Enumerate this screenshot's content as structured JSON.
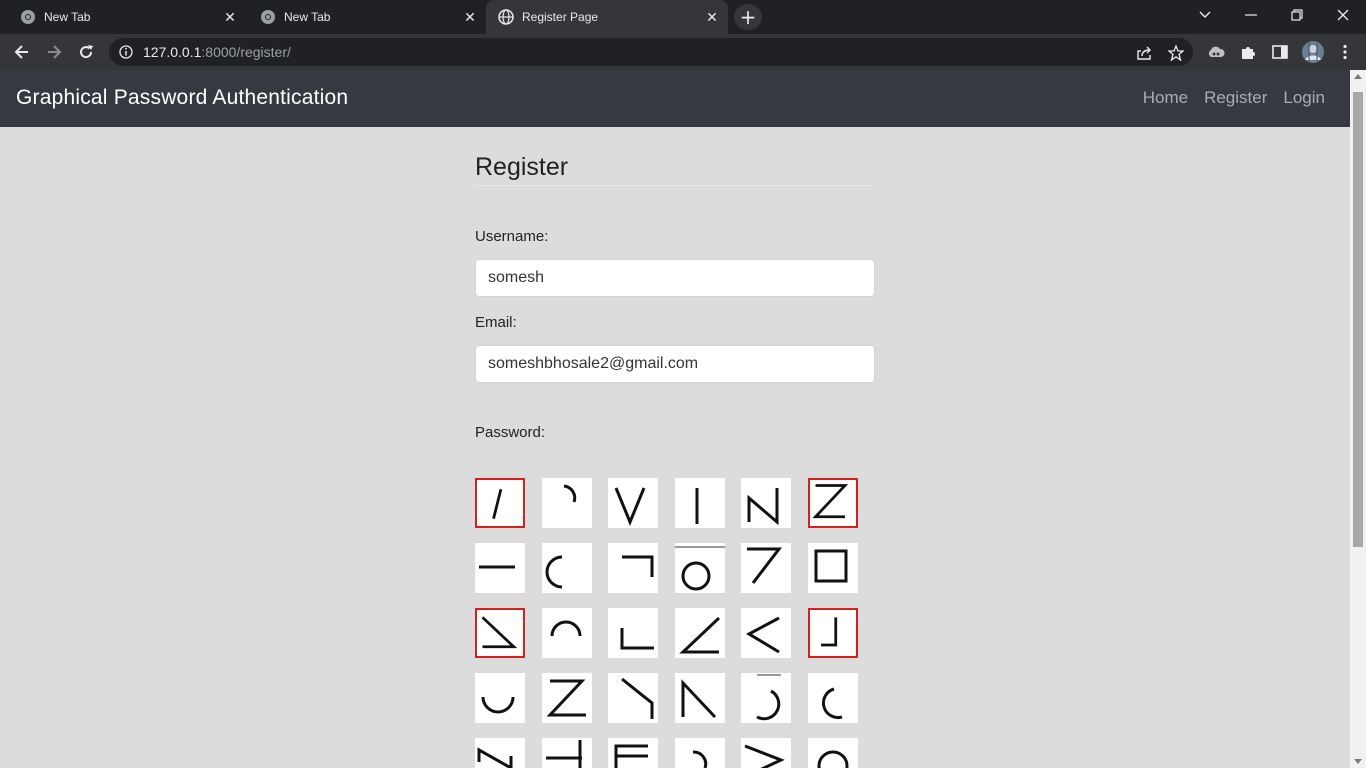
{
  "browser": {
    "tabs": [
      {
        "title": "New Tab",
        "active": false
      },
      {
        "title": "New Tab",
        "active": false
      },
      {
        "title": "Register Page",
        "active": true
      }
    ],
    "url_host": "127.0.0.1",
    "url_rest": ":8000/register/",
    "window_controls": [
      "chevron-down-icon",
      "minimize-icon",
      "restore-icon",
      "close-icon"
    ],
    "toolbar_icons": [
      "back-icon",
      "forward-icon",
      "reload-icon",
      "info-icon",
      "share-icon",
      "star-icon",
      "extension-cloud-icon",
      "puzzle-icon",
      "sidepanel-icon",
      "profile-avatar",
      "kebab-menu-icon"
    ]
  },
  "navbar": {
    "brand": "Graphical Password Authentication",
    "links": [
      "Home",
      "Register",
      "Login"
    ]
  },
  "form": {
    "heading": "Register",
    "username_label": "Username:",
    "username_value": "somesh",
    "email_label": "Email:",
    "email_value": "someshbhosale2@gmail.com",
    "password_label": "Password:"
  },
  "password_grid": {
    "columns": 6,
    "selected_color": "#d91e1e",
    "tiles": [
      {
        "shape": "slash",
        "selected": true
      },
      {
        "shape": "arc-top-right",
        "selected": false
      },
      {
        "shape": "v",
        "selected": false
      },
      {
        "shape": "vertical-line",
        "selected": false
      },
      {
        "shape": "n",
        "selected": false
      },
      {
        "shape": "z",
        "selected": true
      },
      {
        "shape": "horizontal-line",
        "selected": false
      },
      {
        "shape": "arc-left",
        "selected": false
      },
      {
        "shape": "corner-top-right",
        "selected": false
      },
      {
        "shape": "circle-bar",
        "selected": false
      },
      {
        "shape": "seven",
        "selected": false
      },
      {
        "shape": "square",
        "selected": false
      },
      {
        "shape": "triangle-down",
        "selected": true
      },
      {
        "shape": "arch",
        "selected": false
      },
      {
        "shape": "corner-bottom-left",
        "selected": false
      },
      {
        "shape": "angle",
        "selected": false
      },
      {
        "shape": "less-than",
        "selected": false
      },
      {
        "shape": "corner-bottom-right",
        "selected": true
      },
      {
        "shape": "cup",
        "selected": false
      },
      {
        "shape": "z-slant",
        "selected": false
      },
      {
        "shape": "reverse-seven",
        "selected": false
      },
      {
        "shape": "n-slant",
        "selected": false
      },
      {
        "shape": "hook",
        "selected": false
      },
      {
        "shape": "c-small",
        "selected": false
      },
      {
        "shape": "n-partial",
        "selected": false
      },
      {
        "shape": "t-partial",
        "selected": false
      },
      {
        "shape": "e-partial",
        "selected": false
      },
      {
        "shape": "arc-partial",
        "selected": false
      },
      {
        "shape": "greater-partial",
        "selected": false
      },
      {
        "shape": "circle-partial",
        "selected": false
      }
    ]
  }
}
